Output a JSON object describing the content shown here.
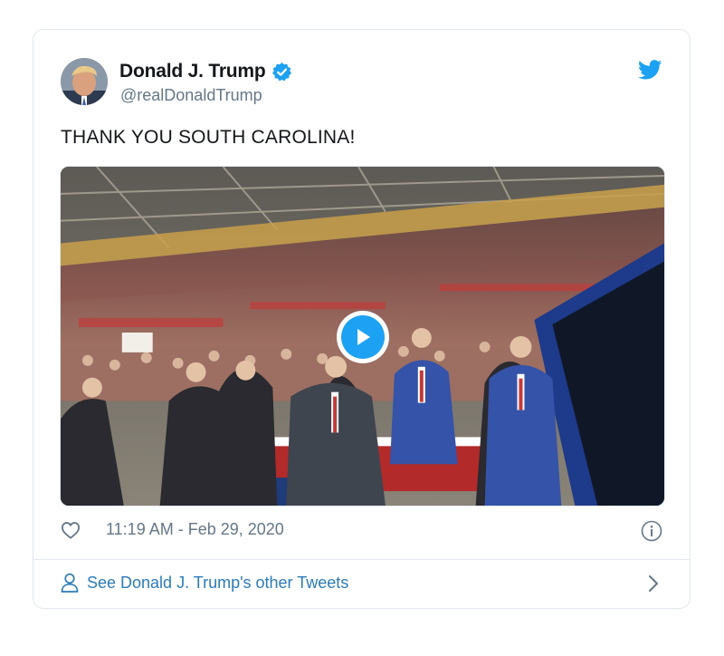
{
  "tweet": {
    "display_name": "Donald J. Trump",
    "handle": "@realDonaldTrump",
    "text": "THANK YOU SOUTH CAROLINA!",
    "timestamp": "11:19 AM - Feb 29, 2020",
    "verified": true
  },
  "footer": {
    "link_text": "See Donald J. Trump's other Tweets"
  },
  "icons": {
    "avatar": "profile-photo",
    "verified": "verified-badge-icon",
    "brand": "twitter-bird-icon",
    "play": "play-icon",
    "like": "heart-icon",
    "info": "info-icon",
    "profile": "person-icon",
    "next": "chevron-right-icon"
  },
  "colors": {
    "accent": "#1da1f2",
    "link": "#2b7bb9",
    "muted": "#657786",
    "border": "#e1e8ed"
  }
}
